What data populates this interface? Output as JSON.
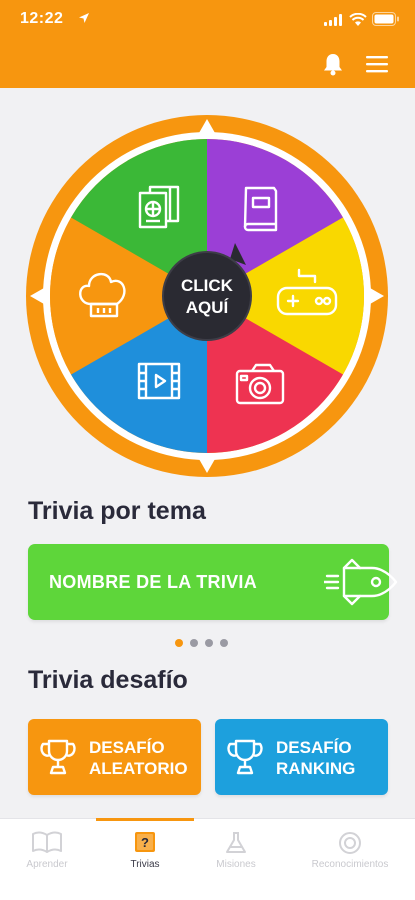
{
  "status_bar": {
    "time": "12:22"
  },
  "wheel": {
    "center_label_line1": "CLICK",
    "center_label_line2": "AQUÍ",
    "segments": [
      {
        "category": "Libros",
        "icon": "book-icon",
        "color": "#9b3fd6"
      },
      {
        "category": "Videojuegos",
        "icon": "gamepad-icon",
        "color": "#f9d800"
      },
      {
        "category": "Fotografía",
        "icon": "camera-icon",
        "color": "#ee3351"
      },
      {
        "category": "Cine",
        "icon": "film-icon",
        "color": "#1f8fdb"
      },
      {
        "category": "Cocina",
        "icon": "chef-hat-icon",
        "color": "#f7960f"
      },
      {
        "category": "Viajes",
        "icon": "passport-icon",
        "color": "#3bb837"
      }
    ]
  },
  "sections": {
    "topic_title": "Trivia por tema",
    "topic_card_label": "NOMBRE DE LA TRIVIA",
    "carousel": {
      "count": 4,
      "active": 1
    },
    "challenge_title": "Trivia desafío",
    "challenge_random_line1": "DESAFÍO",
    "challenge_random_line2": "ALEATORIO",
    "challenge_ranking_line1": "DESAFÍO",
    "challenge_ranking_line2": "RANKING"
  },
  "tabs": [
    {
      "label": "Aprender",
      "icon": "book-open-icon",
      "active": false
    },
    {
      "label": "Trivias",
      "icon": "question-icon",
      "active": true
    },
    {
      "label": "Misiones",
      "icon": "flask-icon",
      "active": false
    },
    {
      "label": "Reconocimientos",
      "icon": "medal-icon",
      "active": false
    }
  ],
  "colors": {
    "brand_orange": "#f7960f",
    "green": "#5ed63a",
    "blue": "#1da0dd",
    "background": "#f1f1f3"
  }
}
